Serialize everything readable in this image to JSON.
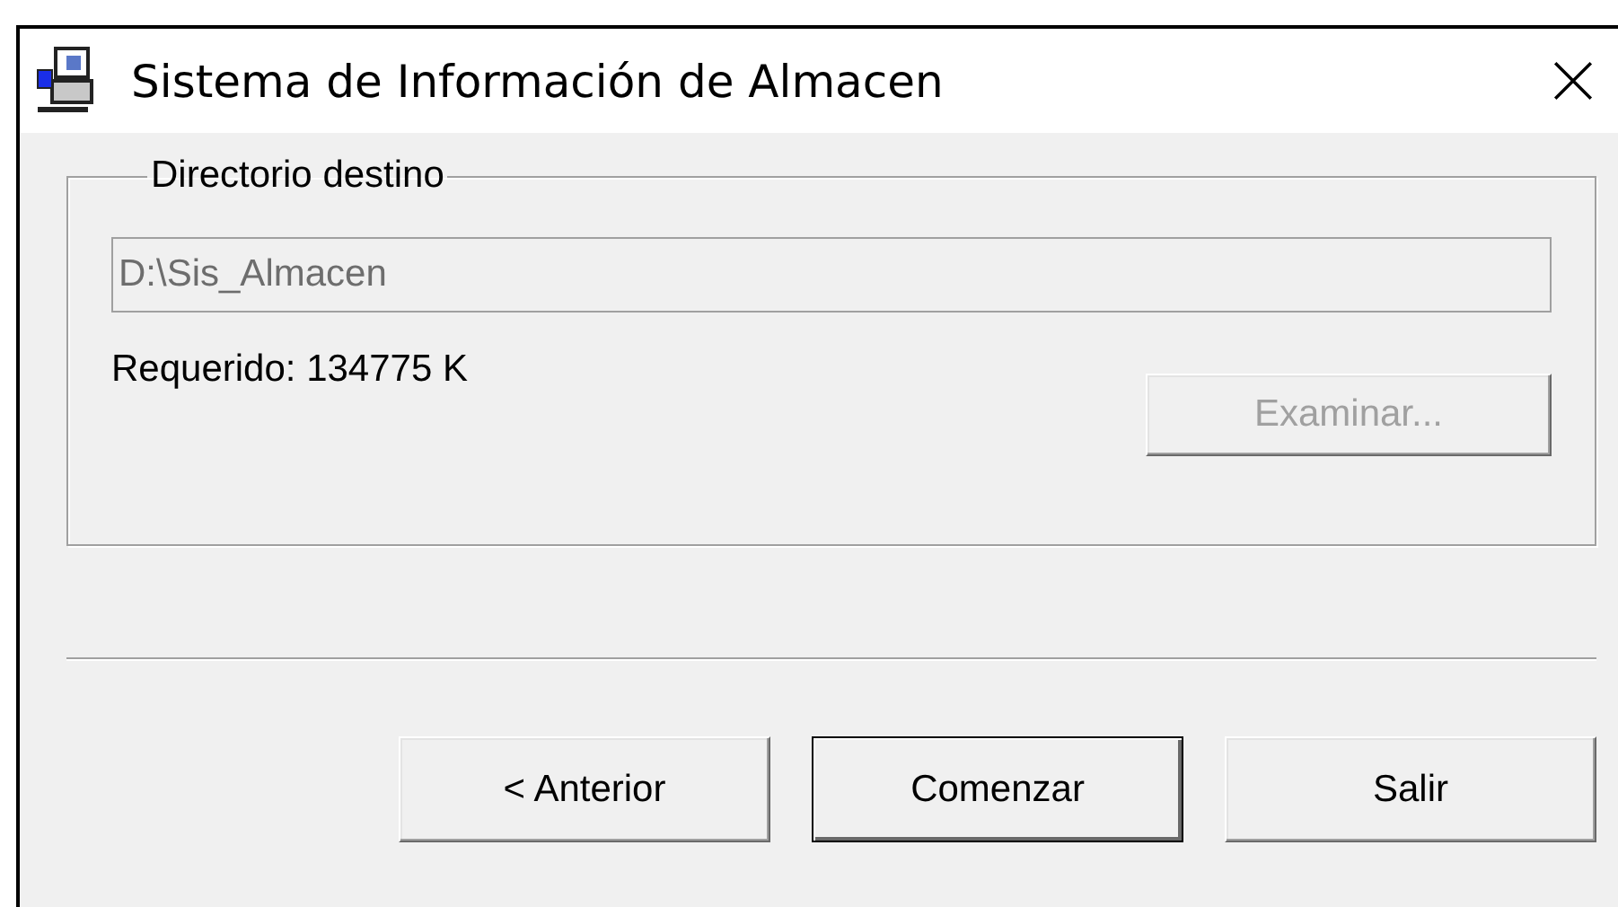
{
  "window": {
    "title": "Sistema de Información de Almacen"
  },
  "group": {
    "label": "Directorio destino",
    "field": {
      "value": "D:\\Sis_Almacen",
      "disabled": true
    },
    "required": "Requerido: 134775 K",
    "browse_button": {
      "label": "Examinar...",
      "disabled": true
    }
  },
  "buttons": [
    {
      "label": "< Anterior",
      "default": false
    },
    {
      "label": "Comenzar",
      "default": true
    },
    {
      "label": "Salir",
      "default": false
    }
  ]
}
